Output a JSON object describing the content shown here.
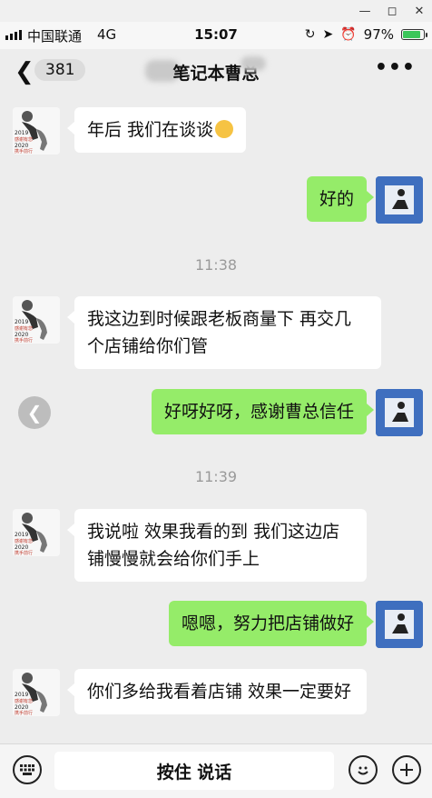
{
  "status_bar": {
    "carrier": "中国联通",
    "network": "4G",
    "time": "15:07",
    "battery_percent": "97%",
    "battery_level": 0.97
  },
  "nav": {
    "unread_count": "381",
    "title": "笔记本曹总"
  },
  "messages": [
    {
      "side": "left",
      "text": "年后 我们在谈谈"
    },
    {
      "side": "right",
      "text": "好的"
    },
    {
      "type": "time",
      "text": "11:38"
    },
    {
      "side": "left",
      "text": "我这边到时候跟老板商量下  再交几个店铺给你们管"
    },
    {
      "side": "right",
      "text": "好呀好呀，感谢曹总信任"
    },
    {
      "type": "time",
      "text": "11:39"
    },
    {
      "side": "left",
      "text": "我说啦  效果我看的到  我们这边店铺慢慢就会给你们手上"
    },
    {
      "side": "right",
      "text": "嗯嗯，努力把店铺做好"
    },
    {
      "side": "left",
      "text": "你们多给我看着店铺  效果一定要好"
    }
  ],
  "avatar_left_text": [
    "2019",
    "感谢有您",
    "2020",
    "携手前行"
  ],
  "input_bar": {
    "hold_to_talk": "按住 说话"
  },
  "colors": {
    "sent_bubble": "#95ec69",
    "received_bubble": "#ffffff",
    "background": "#ededed"
  }
}
